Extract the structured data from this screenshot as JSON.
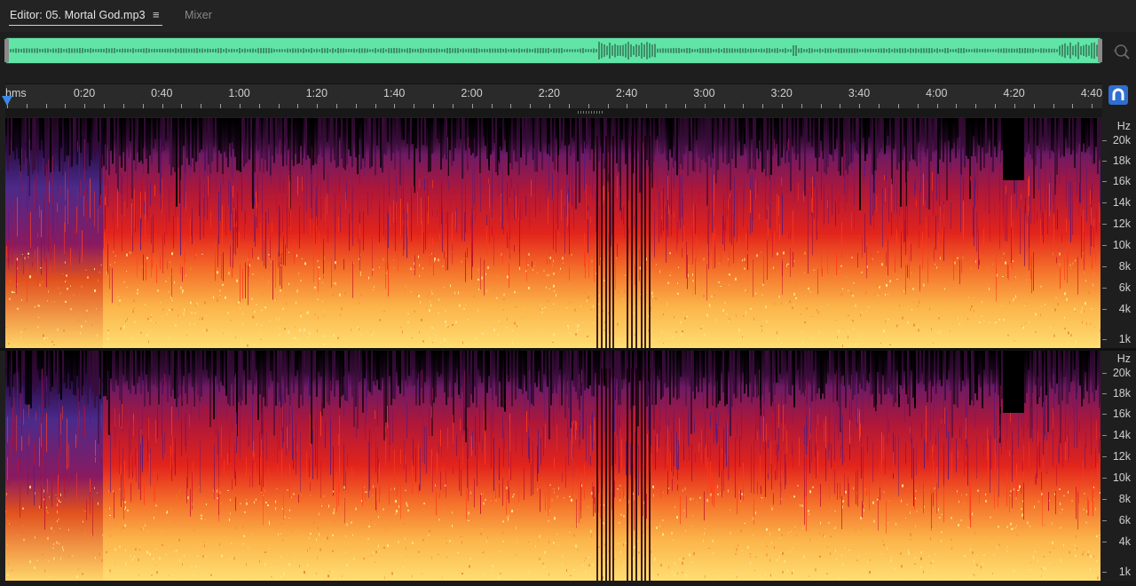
{
  "tabs": {
    "editor_label": "Editor: 05. Mortal God.mp3",
    "menu_glyph": "≡",
    "mixer_label": "Mixer"
  },
  "overview": {
    "zoom_icon": "zoom-navigator-icon"
  },
  "ruler": {
    "labels": [
      "hms",
      "0:20",
      "0:40",
      "1:00",
      "1:20",
      "1:40",
      "2:00",
      "2:20",
      "2:40",
      "3:00",
      "3:20",
      "3:40",
      "4:00",
      "4:20",
      "4:40"
    ],
    "snap_icon": "magnet-icon"
  },
  "frequency_axis": {
    "unit": "Hz",
    "labels": [
      "20k",
      "18k",
      "16k",
      "14k",
      "12k",
      "10k",
      "8k",
      "6k",
      "4k",
      "1k"
    ]
  },
  "colors": {
    "overview_waveform": "#60e5a6",
    "accent": "#3b88e8",
    "spectrum_low": "#ffd25a",
    "spectrum_mid": "#e8241e",
    "spectrum_high": "#7a1f6e"
  }
}
